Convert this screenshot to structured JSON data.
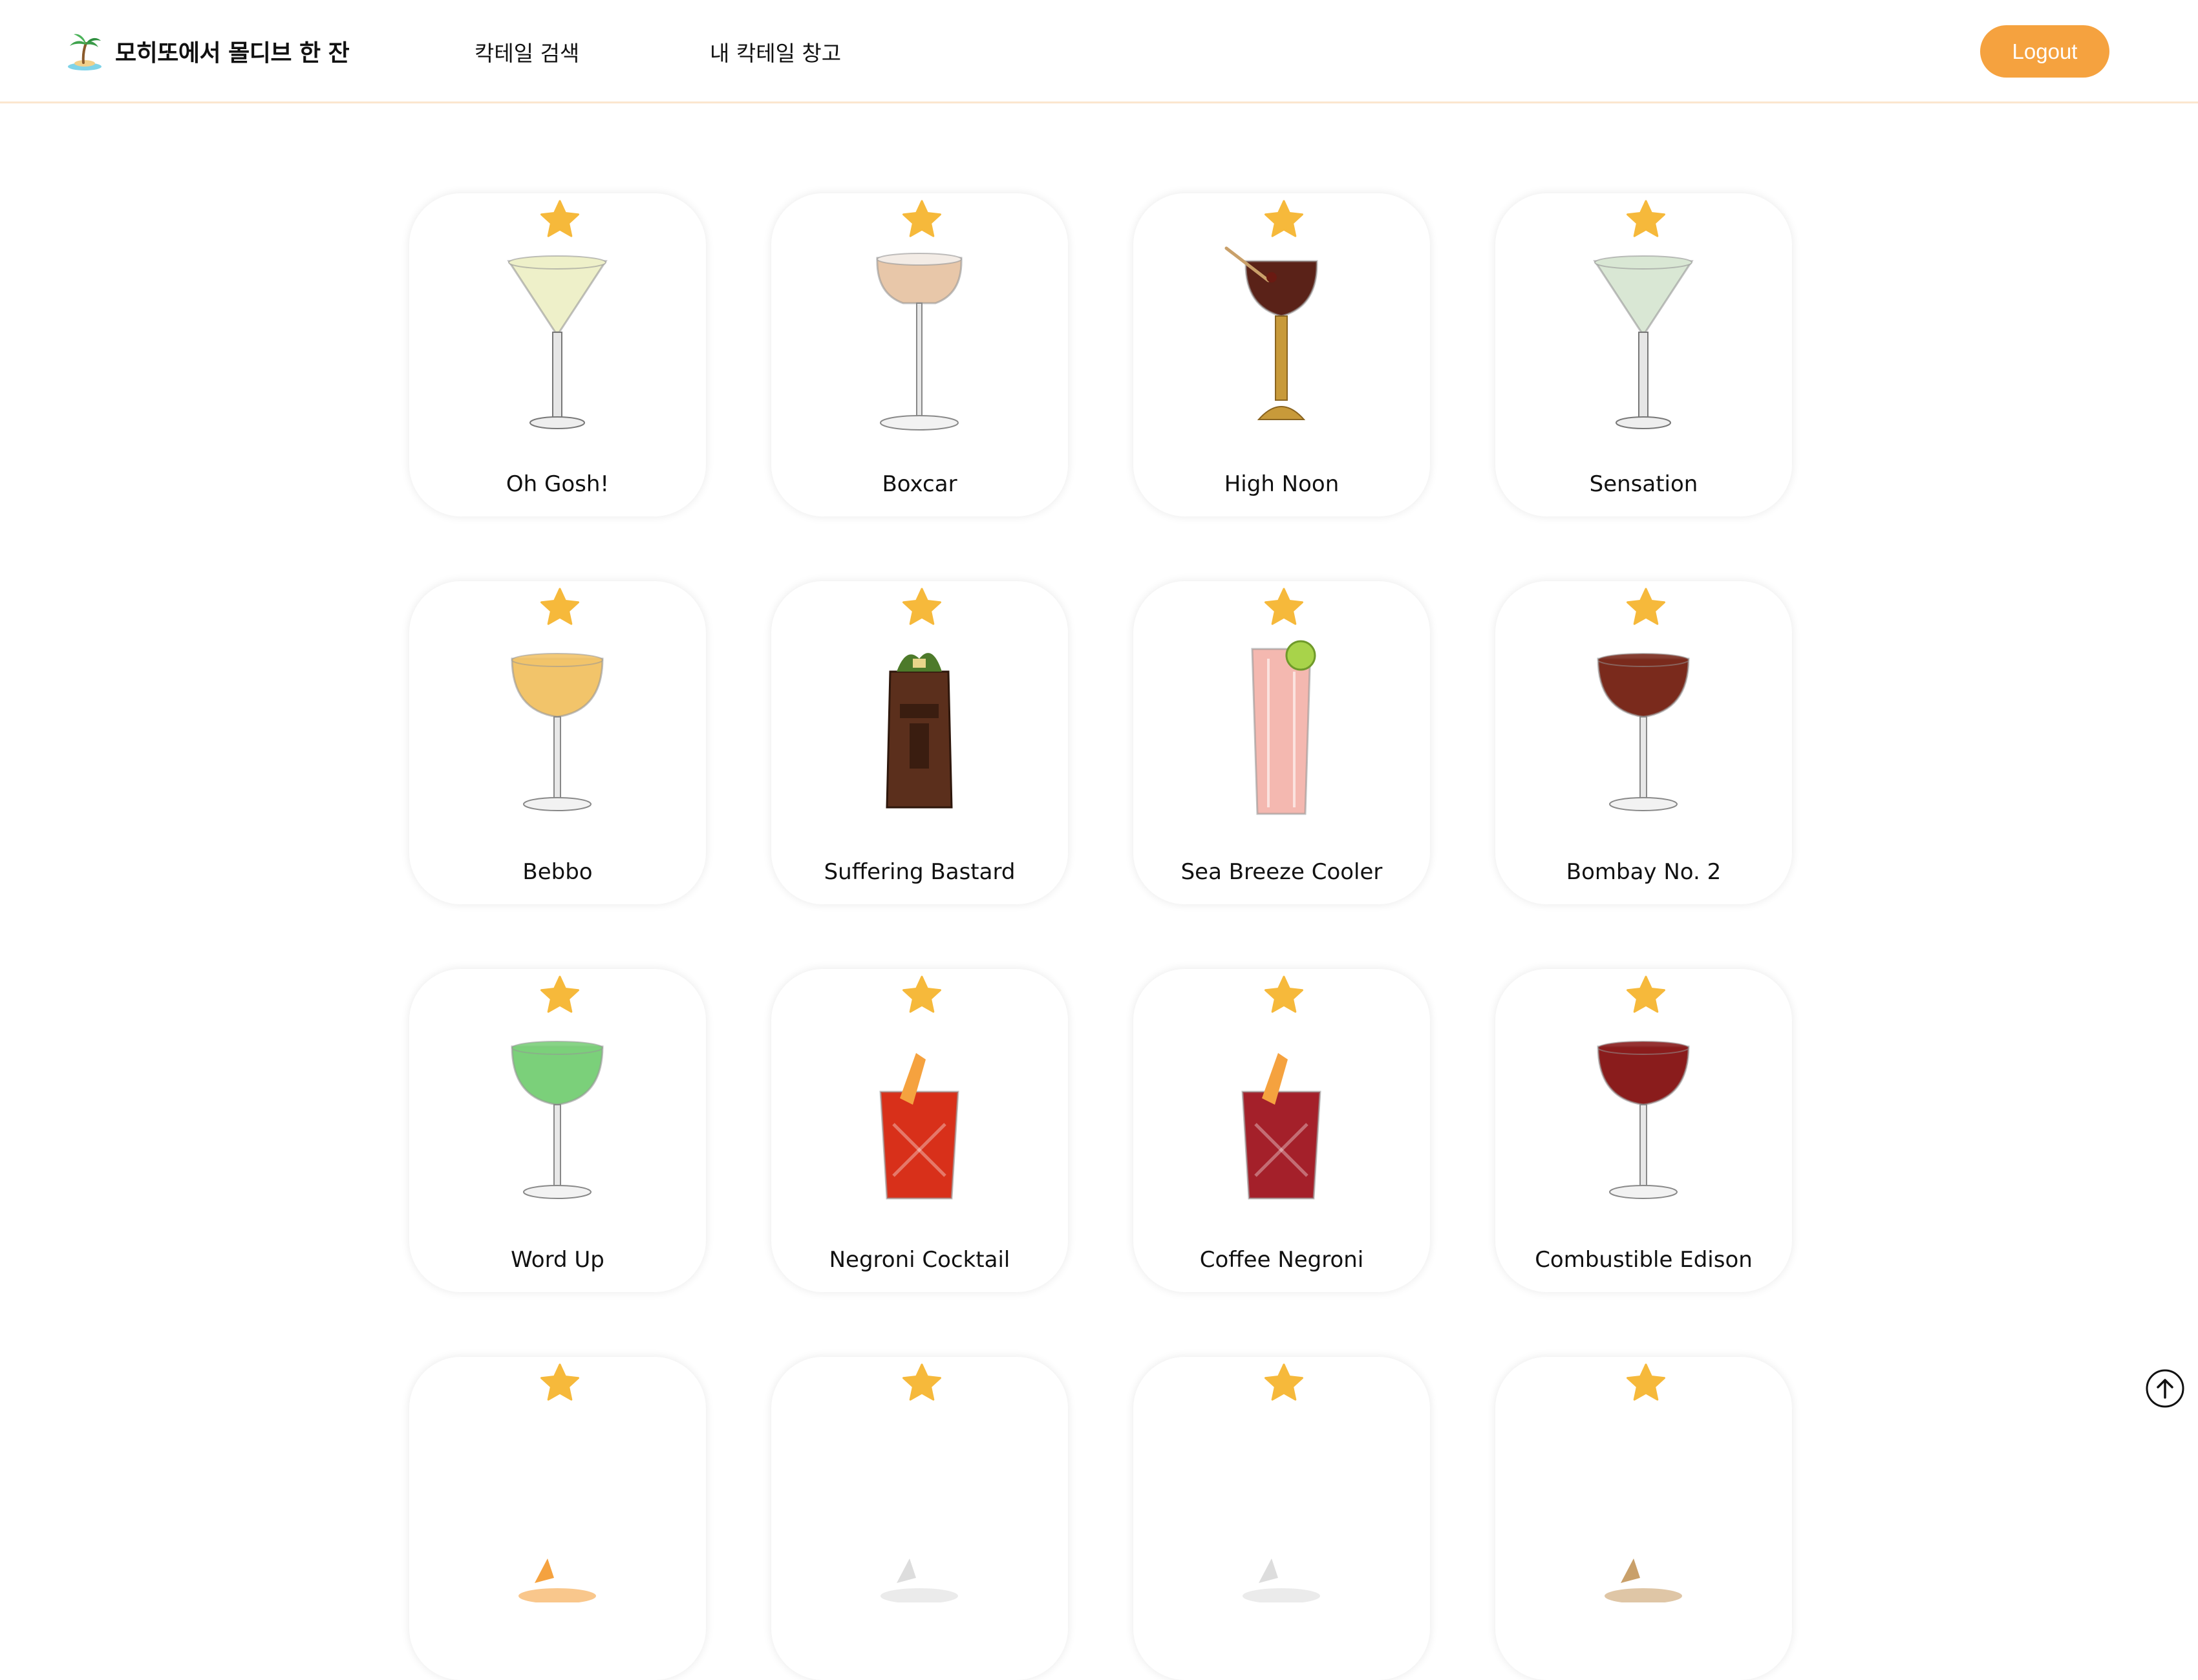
{
  "header": {
    "brand_icon": "palm-island-icon",
    "title": "모히또에서 몰디브 한 잔",
    "nav": {
      "search": "칵테일 검색",
      "storage": "내 칵테일 창고"
    },
    "logout_label": "Logout"
  },
  "colors": {
    "accent": "#f5a23f",
    "star": "#f6b93b",
    "header_border": "#fbe6cf"
  },
  "cocktails": [
    {
      "name": "Oh Gosh!",
      "favorite": true,
      "drink_color": "#eef0c9",
      "glass": "martini"
    },
    {
      "name": "Boxcar",
      "favorite": true,
      "drink_color": "#e8c7a9",
      "glass": "coupe-tall"
    },
    {
      "name": "High Noon",
      "favorite": true,
      "drink_color": "#5a2218",
      "glass": "nick-nora"
    },
    {
      "name": "Sensation",
      "favorite": true,
      "drink_color": "#d9e7d4",
      "glass": "martini"
    },
    {
      "name": "Bebbo",
      "favorite": true,
      "drink_color": "#f2c46a",
      "glass": "coupe"
    },
    {
      "name": "Suffering Bastard",
      "favorite": true,
      "drink_color": "#5b2f1c",
      "glass": "tiki"
    },
    {
      "name": "Sea Breeze Cooler",
      "favorite": true,
      "drink_color": "#f4b8b0",
      "glass": "highball"
    },
    {
      "name": "Bombay No. 2",
      "favorite": true,
      "drink_color": "#7a2a1c",
      "glass": "coupe"
    },
    {
      "name": "Word Up",
      "favorite": true,
      "drink_color": "#7bd07a",
      "glass": "coupe"
    },
    {
      "name": "Negroni Cocktail",
      "favorite": true,
      "drink_color": "#d8301a",
      "glass": "rocks"
    },
    {
      "name": "Coffee Negroni",
      "favorite": true,
      "drink_color": "#a4202a",
      "glass": "rocks"
    },
    {
      "name": "Combustible Edison",
      "favorite": true,
      "drink_color": "#8a1c1c",
      "glass": "coupe"
    },
    {
      "name": "",
      "favorite": true,
      "drink_color": "#f5a23f",
      "glass": "partial"
    },
    {
      "name": "",
      "favorite": true,
      "drink_color": "#dddddd",
      "glass": "partial"
    },
    {
      "name": "",
      "favorite": true,
      "drink_color": "#dddddd",
      "glass": "partial"
    },
    {
      "name": "",
      "favorite": true,
      "drink_color": "#c9a06a",
      "glass": "partial"
    }
  ],
  "scroll_top_icon": "arrow-up-circle-icon"
}
